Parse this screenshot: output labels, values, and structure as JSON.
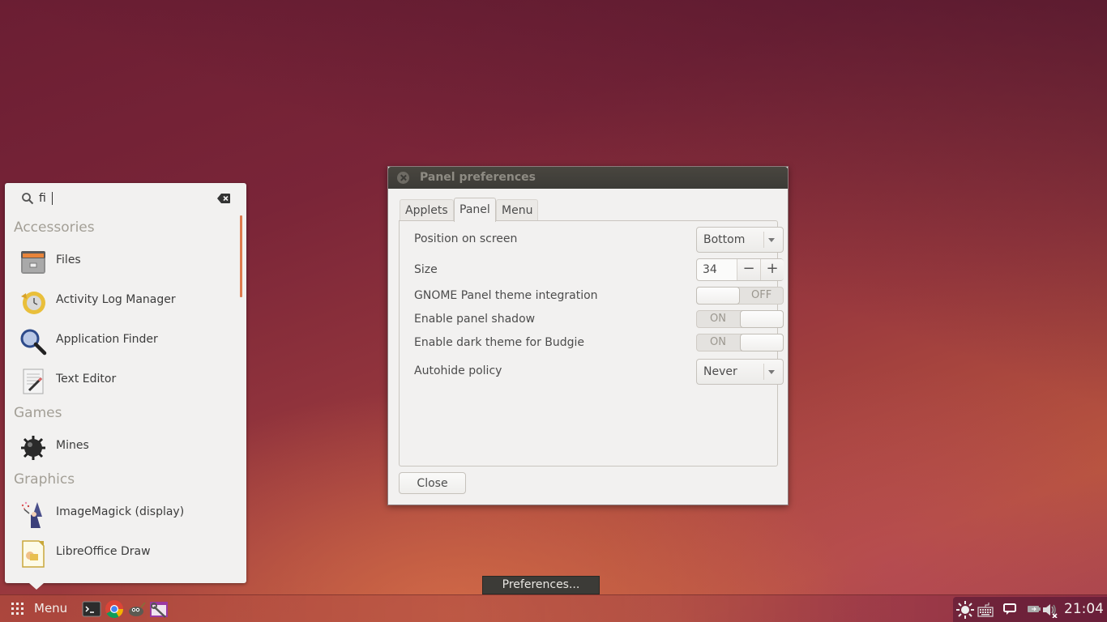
{
  "menu": {
    "search": {
      "value": "fi",
      "placeholder": ""
    },
    "categories": [
      {
        "name": "Accessories",
        "apps": [
          {
            "label": "Files",
            "icon": "file-cabinet-icon"
          },
          {
            "label": "Activity Log Manager",
            "icon": "history-clock-icon"
          },
          {
            "label": "Application Finder",
            "icon": "magnifier-icon"
          },
          {
            "label": "Text Editor",
            "icon": "text-editor-icon"
          }
        ]
      },
      {
        "name": "Games",
        "apps": [
          {
            "label": "Mines",
            "icon": "mine-icon"
          }
        ]
      },
      {
        "name": "Graphics",
        "apps": [
          {
            "label": "ImageMagick (display)",
            "icon": "wizard-icon"
          },
          {
            "label": "LibreOffice Draw",
            "icon": "libreoffice-draw-icon"
          }
        ]
      }
    ]
  },
  "dialog": {
    "title": "Panel preferences",
    "tabs": [
      {
        "label": "Applets",
        "active": false
      },
      {
        "label": "Panel",
        "active": true
      },
      {
        "label": "Menu",
        "active": false
      }
    ],
    "settings": {
      "position": {
        "label": "Position on screen",
        "value": "Bottom"
      },
      "size": {
        "label": "Size",
        "value": "34",
        "minus": "−",
        "plus": "+"
      },
      "gnome_theme": {
        "label": "GNOME Panel theme integration",
        "state": "OFF"
      },
      "panel_shadow": {
        "label": "Enable panel shadow",
        "state": "ON"
      },
      "dark_theme": {
        "label": "Enable dark theme for Budgie",
        "state": "ON"
      },
      "autohide": {
        "label": "Autohide policy",
        "value": "Never"
      }
    },
    "close_label": "Close"
  },
  "tooltip": "Preferences...",
  "panel": {
    "menu_label": "Menu",
    "launchers": [
      "terminal-icon",
      "chrome-icon",
      "gimp-icon",
      "settings-tool-icon"
    ],
    "tray": [
      "brightness-icon",
      "keyboard-icon",
      "chat-icon",
      "battery-icon",
      "volume-muted-icon"
    ],
    "clock": "21:04"
  },
  "colors": {
    "accent": "#dd7b4f",
    "category_text": "#a39f96",
    "titlebar": "#3c3b37"
  }
}
